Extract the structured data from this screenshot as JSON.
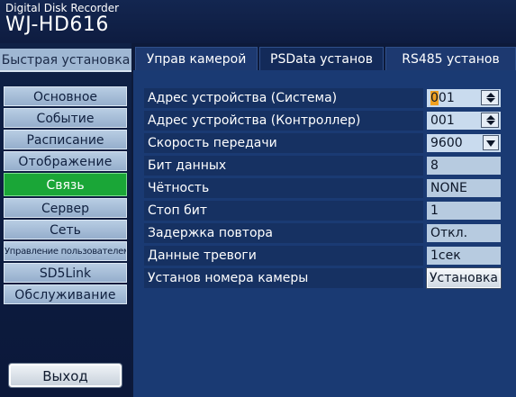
{
  "header": {
    "subtitle": "Digital Disk Recorder",
    "model": "WJ-HD616"
  },
  "sidebar": {
    "quick_setup": "Быстрая установка",
    "items": [
      {
        "label": "Основное"
      },
      {
        "label": "Событие"
      },
      {
        "label": "Расписание"
      },
      {
        "label": "Отображение"
      },
      {
        "label": "Связь"
      },
      {
        "label": "Сервер"
      },
      {
        "label": "Сеть"
      },
      {
        "label": "Управление пользователем"
      },
      {
        "label": "SD5Link"
      },
      {
        "label": "Обслуживание"
      }
    ],
    "active_item": "Связь",
    "logout": "Выход"
  },
  "tabs": [
    {
      "label": "Управ камерой"
    },
    {
      "label": "PSData установ"
    },
    {
      "label": "RS485 установ"
    }
  ],
  "active_tab": "PSData установ",
  "settings": [
    {
      "label": "Адрес устройства (Система)",
      "value": "001",
      "cursor_char": "0",
      "rest": "01",
      "control": "spinner"
    },
    {
      "label": "Адрес устройства (Контроллер)",
      "value": "001",
      "control": "spinner"
    },
    {
      "label": "Скорость передачи",
      "value": "9600",
      "control": "dropdown"
    },
    {
      "label": "Бит данных",
      "value": "8",
      "control": "readonly"
    },
    {
      "label": "Чётность",
      "value": "NONE",
      "control": "readonly"
    },
    {
      "label": "Стоп бит",
      "value": "1",
      "control": "readonly"
    },
    {
      "label": "Задержка повтора",
      "value": "Откл.",
      "control": "readonly"
    },
    {
      "label": "Данные тревоги",
      "value": "1сек",
      "control": "readonly"
    },
    {
      "label": "Установ номера камеры",
      "value": "Установка",
      "control": "button"
    }
  ],
  "colors": {
    "active_menu": "#1aa637",
    "cursor": "#f0a020",
    "panel": "#1a3a73"
  }
}
